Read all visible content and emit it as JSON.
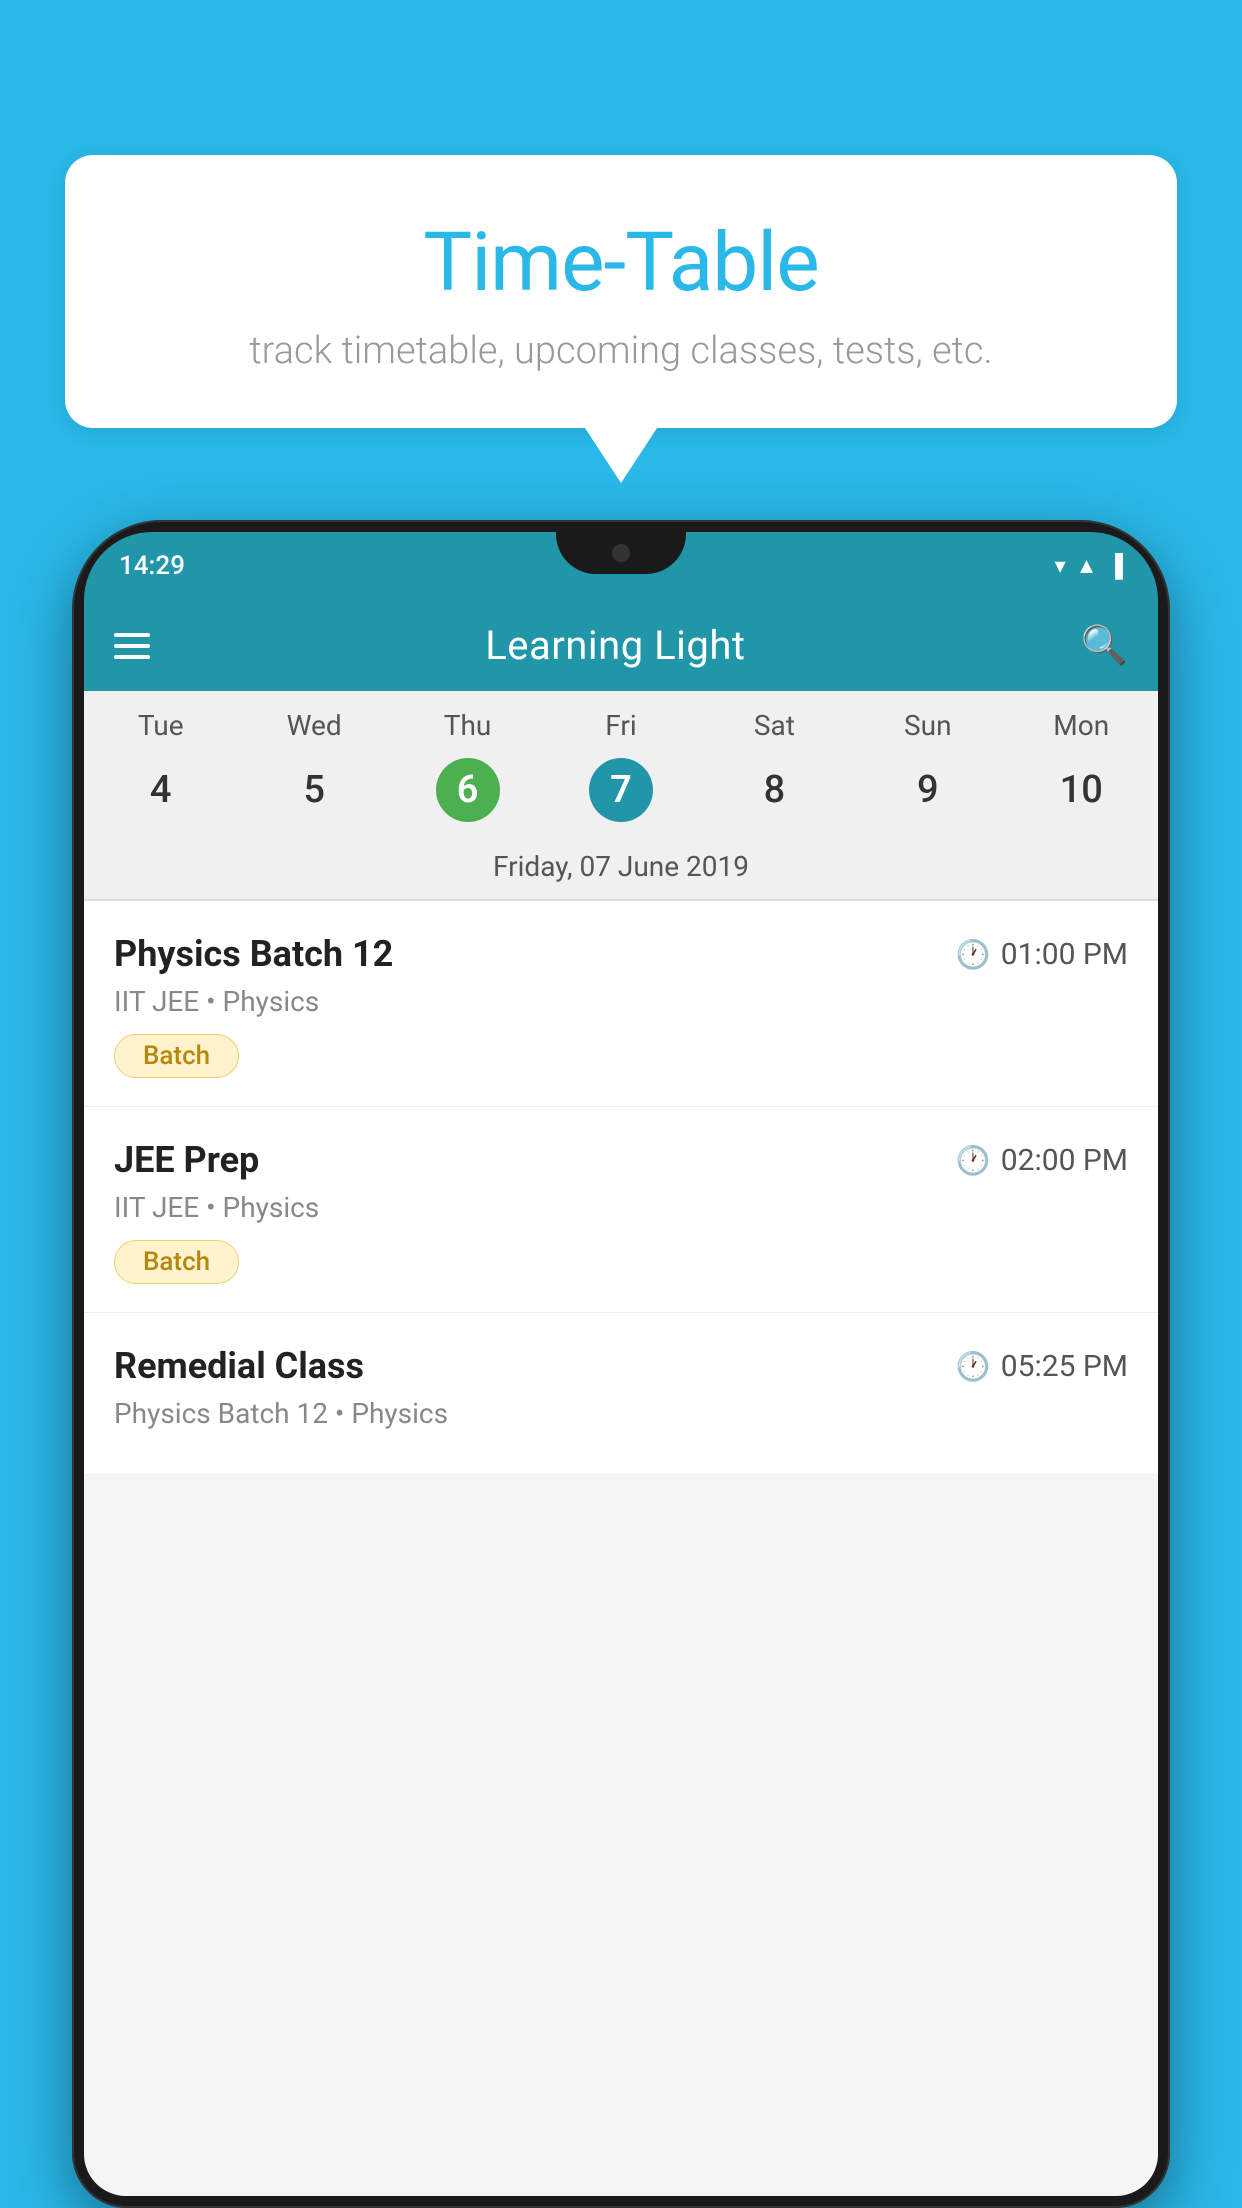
{
  "background_color": "#29b8e8",
  "speech_bubble": {
    "title": "Time-Table",
    "subtitle": "track timetable, upcoming classes, tests, etc."
  },
  "phone": {
    "status_bar": {
      "time": "14:29"
    },
    "app_header": {
      "title": "Learning Light"
    },
    "calendar": {
      "days": [
        {
          "name": "Tue",
          "number": "4",
          "state": "normal"
        },
        {
          "name": "Wed",
          "number": "5",
          "state": "normal"
        },
        {
          "name": "Thu",
          "number": "6",
          "state": "today"
        },
        {
          "name": "Fri",
          "number": "7",
          "state": "selected"
        },
        {
          "name": "Sat",
          "number": "8",
          "state": "normal"
        },
        {
          "name": "Sun",
          "number": "9",
          "state": "normal"
        },
        {
          "name": "Mon",
          "number": "10",
          "state": "normal"
        }
      ],
      "selected_date_label": "Friday, 07 June 2019"
    },
    "schedule_items": [
      {
        "name": "Physics Batch 12",
        "time": "01:00 PM",
        "sub": "IIT JEE • Physics",
        "tag": "Batch"
      },
      {
        "name": "JEE Prep",
        "time": "02:00 PM",
        "sub": "IIT JEE • Physics",
        "tag": "Batch"
      },
      {
        "name": "Remedial Class",
        "time": "05:25 PM",
        "sub": "Physics Batch 12 • Physics",
        "tag": null
      }
    ]
  }
}
